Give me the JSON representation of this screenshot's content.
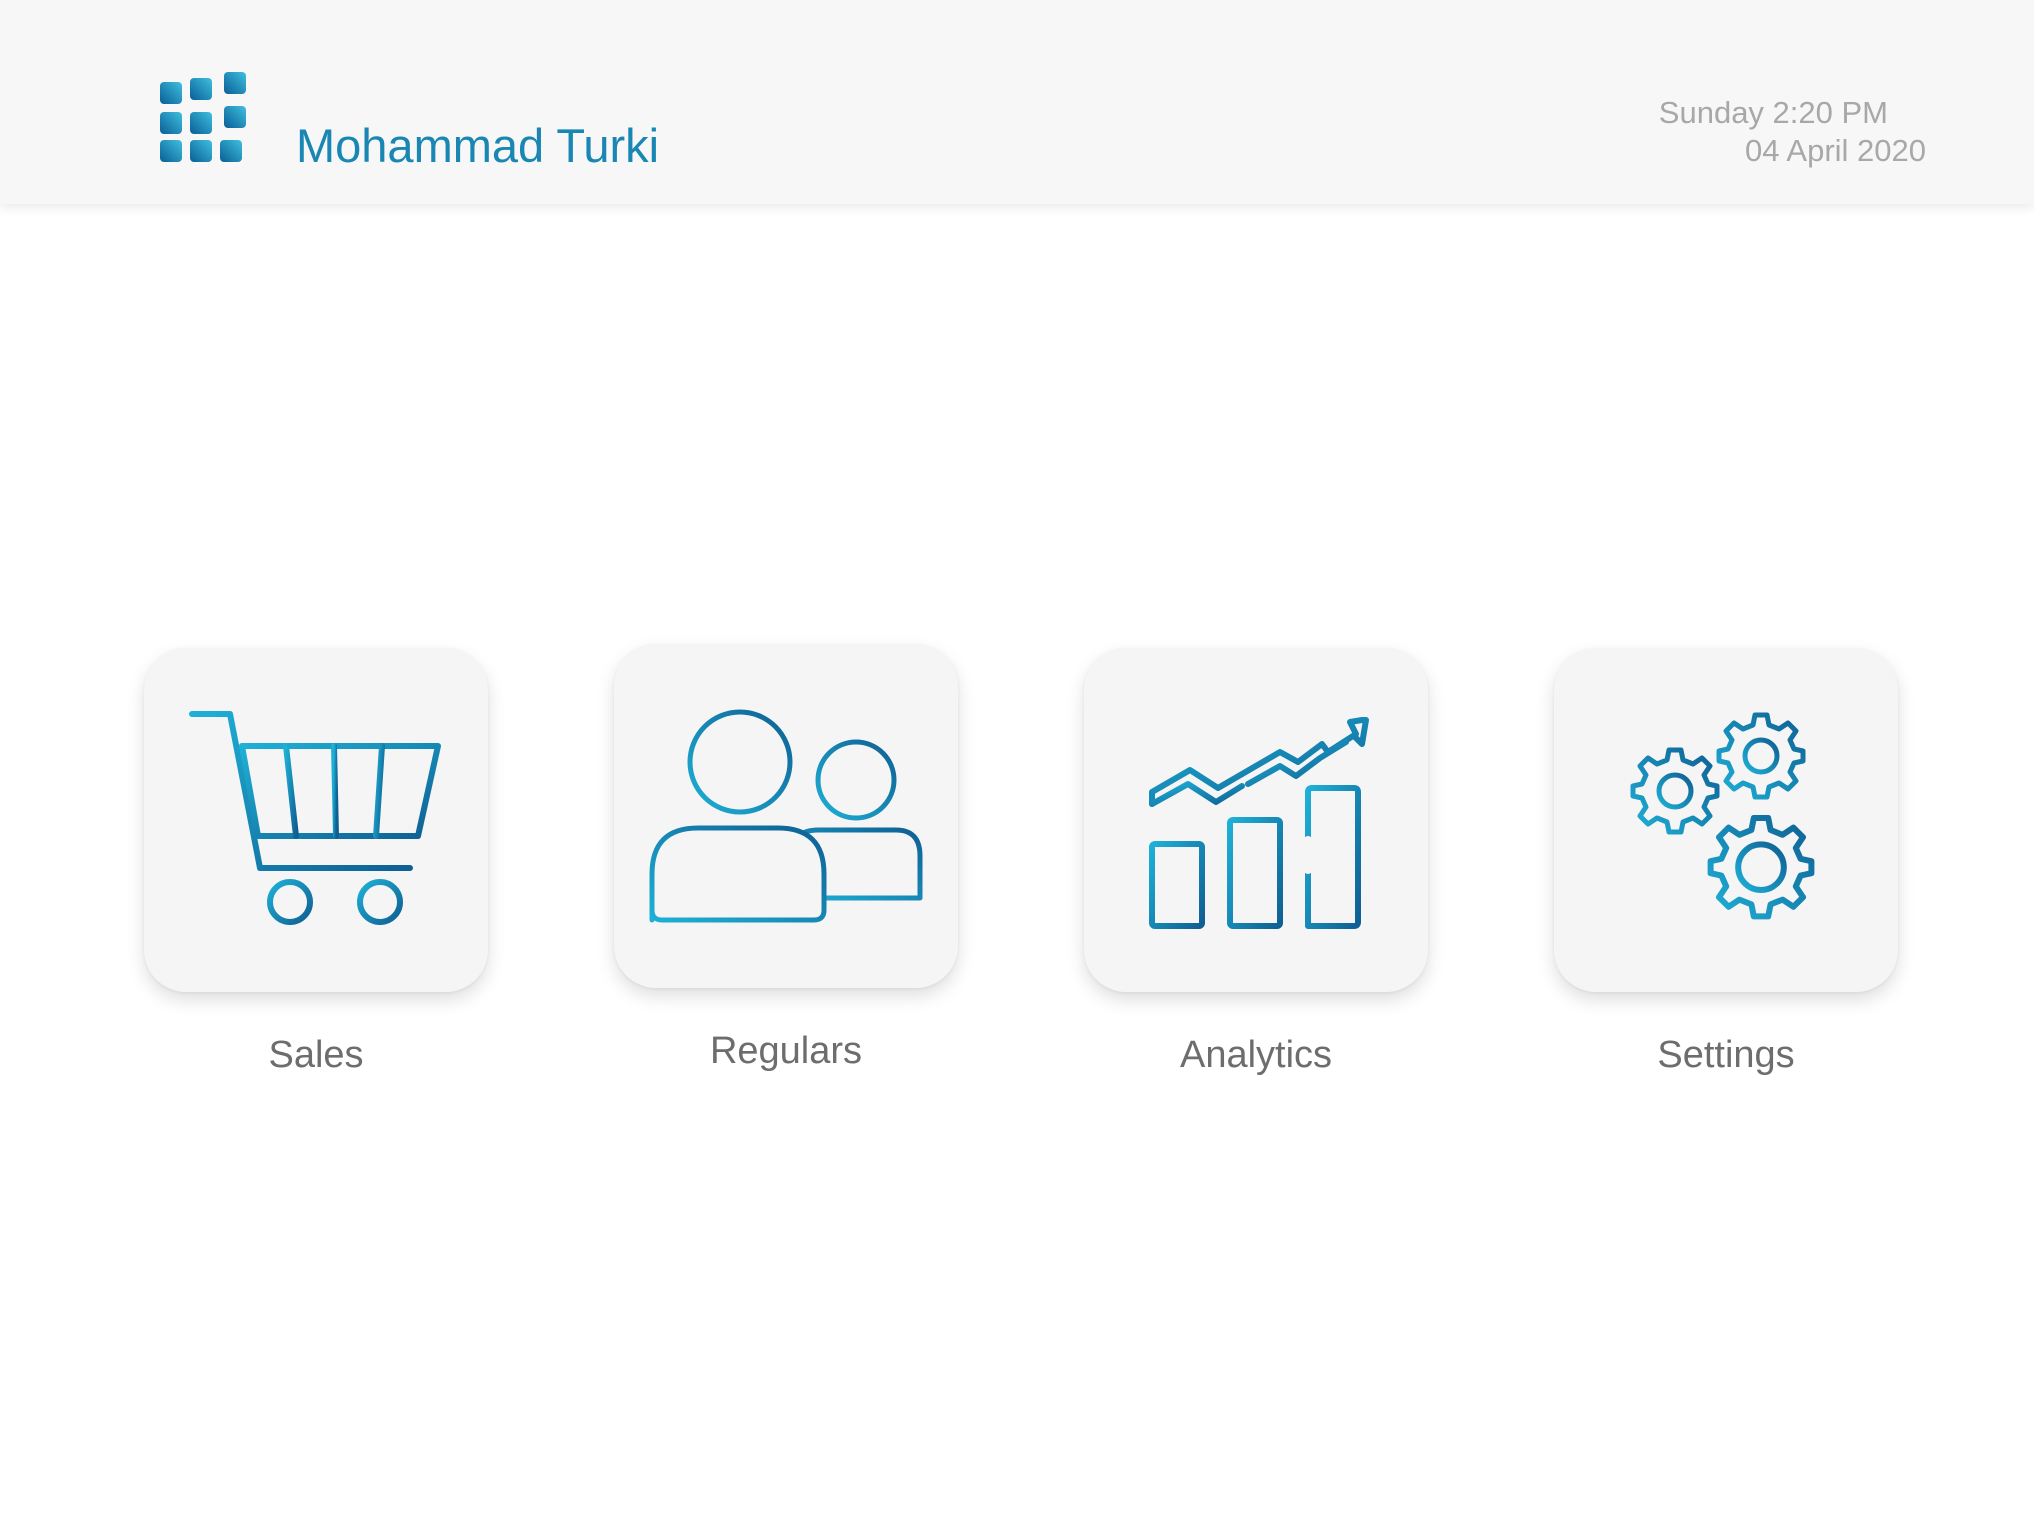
{
  "header": {
    "user_name": "Mohammad Turki",
    "day_time": "Sunday 2:20 PM",
    "date": "04 April 2020",
    "logo_icon": "grid-logo-icon"
  },
  "colors": {
    "brand_blue": "#1a86b3",
    "icon_dark": "#0f5f93",
    "icon_light": "#1eb0d6",
    "label_gray": "#6d6d6d",
    "date_gray": "#a8a8a8"
  },
  "menu": [
    {
      "label": "Sales",
      "icon": "shopping-cart-icon"
    },
    {
      "label": "Regulars",
      "icon": "users-icon"
    },
    {
      "label": "Analytics",
      "icon": "growth-chart-icon"
    },
    {
      "label": "Settings",
      "icon": "gears-icon"
    }
  ]
}
